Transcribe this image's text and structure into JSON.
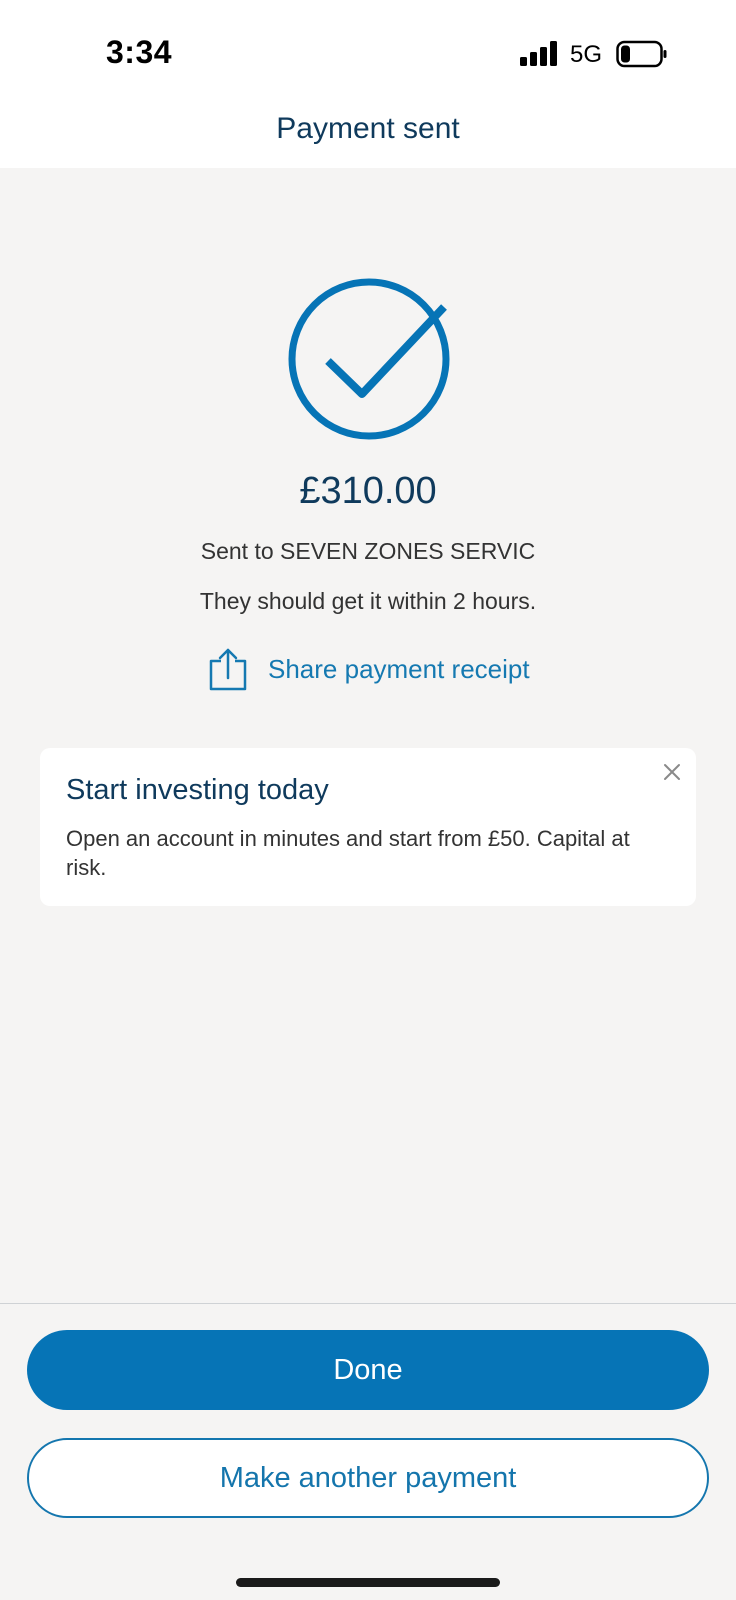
{
  "status_bar": {
    "time": "3:34",
    "network": "5G"
  },
  "header": {
    "title": "Payment sent"
  },
  "confirmation": {
    "amount": "£310.00",
    "recipient_text": "Sent to SEVEN ZONES SERVIC",
    "eta_text": "They should get it within 2 hours.",
    "share_label": "Share payment receipt"
  },
  "promo": {
    "title": "Start investing today",
    "body": "Open an account in minutes and start from £50. Capital at risk."
  },
  "actions": {
    "done_label": "Done",
    "another_label": "Make another payment"
  },
  "colors": {
    "accent": "#0674b6",
    "title_text": "#0f3a5c",
    "background": "#f5f4f3"
  }
}
